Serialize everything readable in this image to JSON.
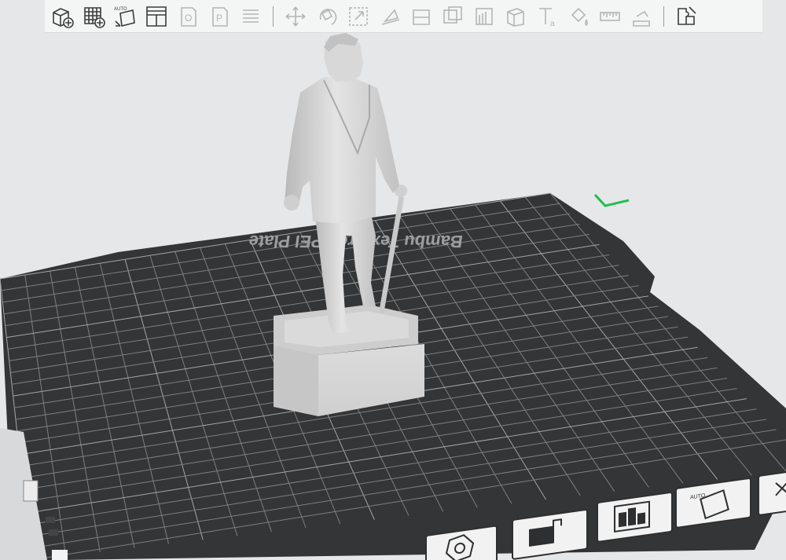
{
  "app": {
    "viewport": "3d-prepare-view"
  },
  "toolbar": {
    "groups": [
      [
        {
          "name": "add-object",
          "icon": "cube-plus-icon",
          "enabled": true
        },
        {
          "name": "add-plate",
          "icon": "grid-plus-icon",
          "enabled": true
        },
        {
          "name": "auto-orient",
          "icon": "auto-orient-icon",
          "enabled": true,
          "badge": "AUTO"
        },
        {
          "name": "arrange",
          "icon": "arrange-icon",
          "enabled": true
        },
        {
          "name": "split-objects",
          "icon": "split-objects-icon",
          "enabled": false,
          "badge": "O"
        },
        {
          "name": "split-parts",
          "icon": "split-parts-icon",
          "enabled": false,
          "badge": "P"
        },
        {
          "name": "layers",
          "icon": "layers-icon",
          "enabled": false
        }
      ],
      [
        {
          "name": "move",
          "icon": "move-icon",
          "enabled": false
        },
        {
          "name": "rotate",
          "icon": "rotate-icon",
          "enabled": false
        },
        {
          "name": "scale",
          "icon": "scale-icon",
          "enabled": false
        },
        {
          "name": "lay-on-face",
          "icon": "lay-on-face-icon",
          "enabled": false
        },
        {
          "name": "cut",
          "icon": "cut-icon",
          "enabled": false
        },
        {
          "name": "boolean",
          "icon": "boolean-icon",
          "enabled": false
        },
        {
          "name": "support-paint",
          "icon": "support-paint-icon",
          "enabled": false
        },
        {
          "name": "seam-paint",
          "icon": "seam-paint-icon",
          "enabled": false
        },
        {
          "name": "text",
          "icon": "text-icon",
          "enabled": false,
          "badge": "T"
        },
        {
          "name": "color-paint",
          "icon": "color-paint-icon",
          "enabled": false
        },
        {
          "name": "measure",
          "icon": "measure-icon",
          "enabled": false
        },
        {
          "name": "assembly",
          "icon": "assembly-icon",
          "enabled": false
        }
      ],
      [
        {
          "name": "assembly-view",
          "icon": "puzzle-icon",
          "enabled": true
        }
      ]
    ]
  },
  "plate": {
    "label": "Bambu Textured PEI Plate",
    "color": "#343536",
    "grid_color": "#8a8c8e",
    "axis_color": "#1fbf4f"
  },
  "model": {
    "name": "statue",
    "color": "#d4d4d4"
  },
  "plate_tools": [
    {
      "name": "slice-plate",
      "icon": "nut-icon"
    },
    {
      "name": "lock-plate",
      "icon": "lock-icon"
    },
    {
      "name": "arrange-plate",
      "icon": "arrange-icon"
    },
    {
      "name": "orient-plate",
      "icon": "auto-orient-icon"
    },
    {
      "name": "plate-settings",
      "icon": "settings-icon"
    }
  ],
  "colors": {
    "background": "#e6e7e8",
    "toolbar": "#f4f5f5",
    "icon_enabled": "#3a3c3e",
    "icon_disabled": "#b3b5b7"
  }
}
